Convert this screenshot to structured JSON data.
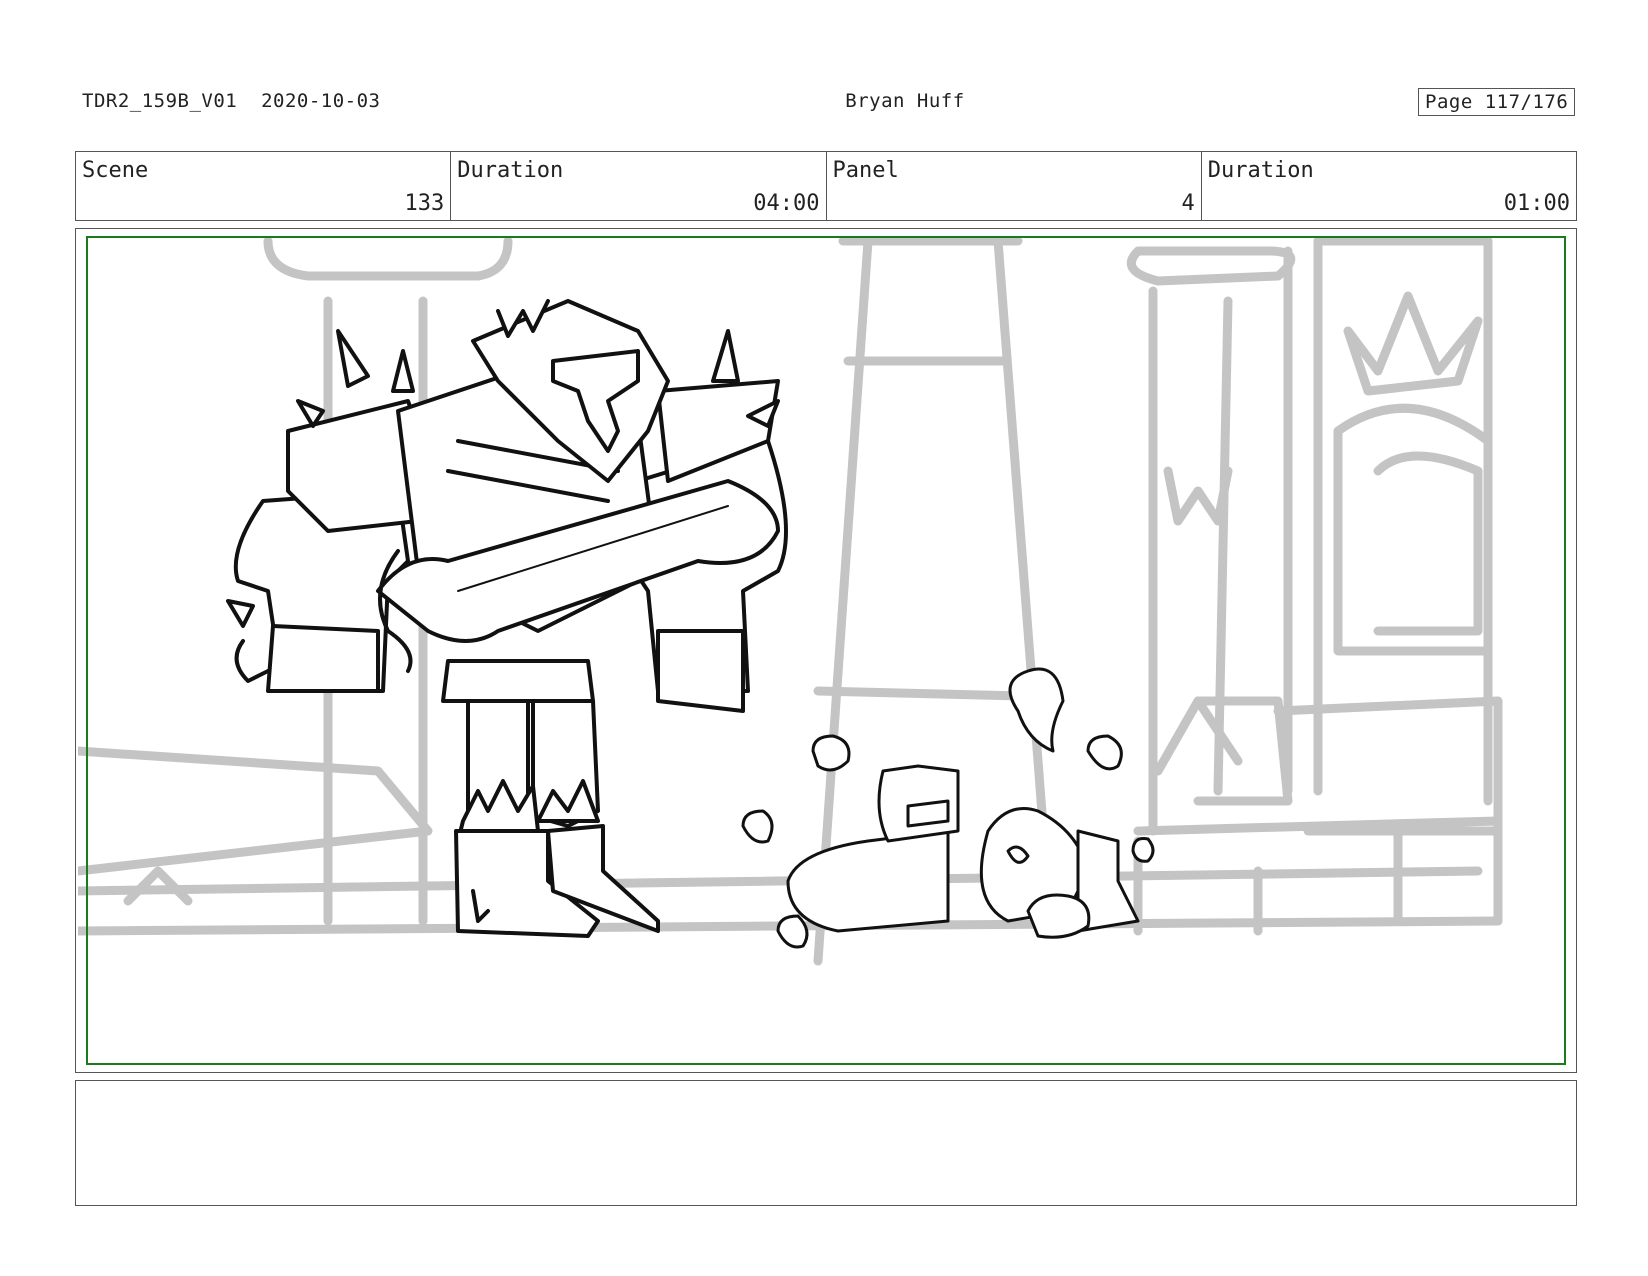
{
  "header": {
    "production_id": "TDR2_159B_V01",
    "date": "2020-10-03",
    "artist": "Bryan Huff",
    "page": "Page 117/176"
  },
  "info": {
    "scene_label": "Scene",
    "scene_value": "133",
    "scene_duration_label": "Duration",
    "scene_duration_value": "04:00",
    "panel_label": "Panel",
    "panel_value": "4",
    "panel_duration_label": "Duration",
    "panel_duration_value": "01:00"
  },
  "colors": {
    "safe_frame": "#1c7a1c",
    "background_sketch": "#c4c4c4",
    "ink": "#111111"
  }
}
